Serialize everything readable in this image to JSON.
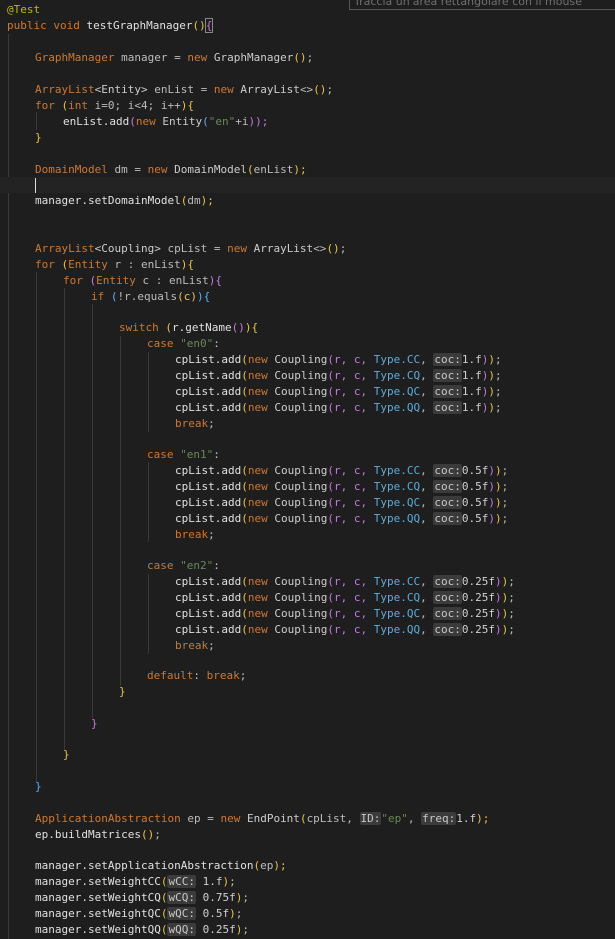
{
  "tooltip": "Traccia un'area rettangolare con il mouse",
  "code": {
    "annotation": "@Test",
    "signature": {
      "kw1": "public",
      "kw2": "void",
      "name": "testGraphManager",
      "paren": "()",
      "brace": "{"
    },
    "l_gm": {
      "type": "GraphManager",
      "var": " manager",
      "eq": " = ",
      "kw": "new",
      "ctor": " GraphManager",
      "args": "()",
      "semi": ";"
    },
    "l_al": {
      "type": "ArrayList",
      "gen": "<Entity>",
      "var": " enList",
      "eq": " = ",
      "kw": "new",
      "ctor": " ArrayList",
      "diamond": "<>",
      "args": "()",
      "semi": ";"
    },
    "l_for1": {
      "kw": "for",
      "open": " (",
      "ty": "int",
      "rest": " i=0; i<4; i++",
      "close": "){"
    },
    "l_add": {
      "call": "enList.add",
      "open": "(",
      "kw": "new",
      "ctor": " Entity",
      "p1": "(",
      "str": "\"en\"",
      "rest": "+i",
      "close": "));"
    },
    "l_close1": "}",
    "l_dm": {
      "type": "DomainModel",
      "var": " dm",
      "eq": " = ",
      "kw": "new",
      "ctor": " DomainModel",
      "open": "(",
      "arg": "enList",
      "close": ");"
    },
    "l_setdm": {
      "call": "manager.setDomainModel",
      "open": "(",
      "arg": "dm",
      "close": ");"
    },
    "l_cp": {
      "type": "ArrayList",
      "gen": "<Coupling>",
      "var": " cpList",
      "eq": " = ",
      "kw": "new",
      "ctor": " ArrayList",
      "diamond": "<>",
      "args": "()",
      "semi": ";"
    },
    "l_for2": {
      "kw": "for",
      "open": " (",
      "ty": "Entity",
      "rest": " r : enList",
      "close": "){"
    },
    "l_for3": {
      "kw": "for",
      "open": " (",
      "ty": "Entity",
      "rest": " c : enList",
      "close": "){"
    },
    "l_if": {
      "kw": "if",
      "open": " (",
      "rest": "!r.equals",
      "p": "(c)",
      "close": "){"
    },
    "l_switch": {
      "kw": "switch",
      "open": " (",
      "rest": "r.getName",
      "p": "()",
      "close": "){"
    },
    "cases": [
      {
        "label": "case",
        "str": "\"en0\"",
        "colon": ":",
        "types": [
          "CC",
          "CQ",
          "QC",
          "QQ"
        ],
        "coc": "1.f"
      },
      {
        "label": "case",
        "str": "\"en1\"",
        "colon": ":",
        "types": [
          "CC",
          "CQ",
          "QC",
          "QQ"
        ],
        "coc": "0.5f"
      },
      {
        "label": "case",
        "str": "\"en2\"",
        "colon": ":",
        "types": [
          "CC",
          "CQ",
          "QC",
          "QQ"
        ],
        "coc": "0.25f"
      }
    ],
    "add_prefix": "cpList.add",
    "new_kw": "new",
    "coupling": " Coupling",
    "args_rc": "(r, c, ",
    "type_prefix": "Type.",
    "coc_hint": "coc:",
    "break_kw": "break",
    "default": {
      "kw": "default",
      "colon": ":",
      "brk": "break",
      "semi": ";"
    },
    "closing": "}",
    "l_ep": {
      "type": "ApplicationAbstraction",
      "var": " ep",
      "eq": " = ",
      "kw": "new",
      "ctor": " EndPoint",
      "open": "(",
      "arg": "cpList, ",
      "hint_id": "ID:",
      "str": "\"ep\"",
      "sep": ", ",
      "hint_freq": "freq:",
      "num": "1.f",
      "close": ");"
    },
    "l_build": {
      "call": "ep.buildMatrices",
      "p": "()",
      "semi": ";"
    },
    "l_setaa": {
      "call": "manager.setApplicationAbstraction",
      "open": "(",
      "arg": "ep",
      "close": ");"
    },
    "weights": [
      {
        "call": "manager.setWeightCC",
        "hint": "wCC:",
        "val": "1.f"
      },
      {
        "call": "manager.setWeightCQ",
        "hint": "wCQ:",
        "val": "0.75f"
      },
      {
        "call": "manager.setWeightQC",
        "hint": "wQC:",
        "val": "0.5f"
      },
      {
        "call": "manager.setWeightQQ",
        "hint": "wQQ:",
        "val": "0.25f"
      }
    ]
  }
}
